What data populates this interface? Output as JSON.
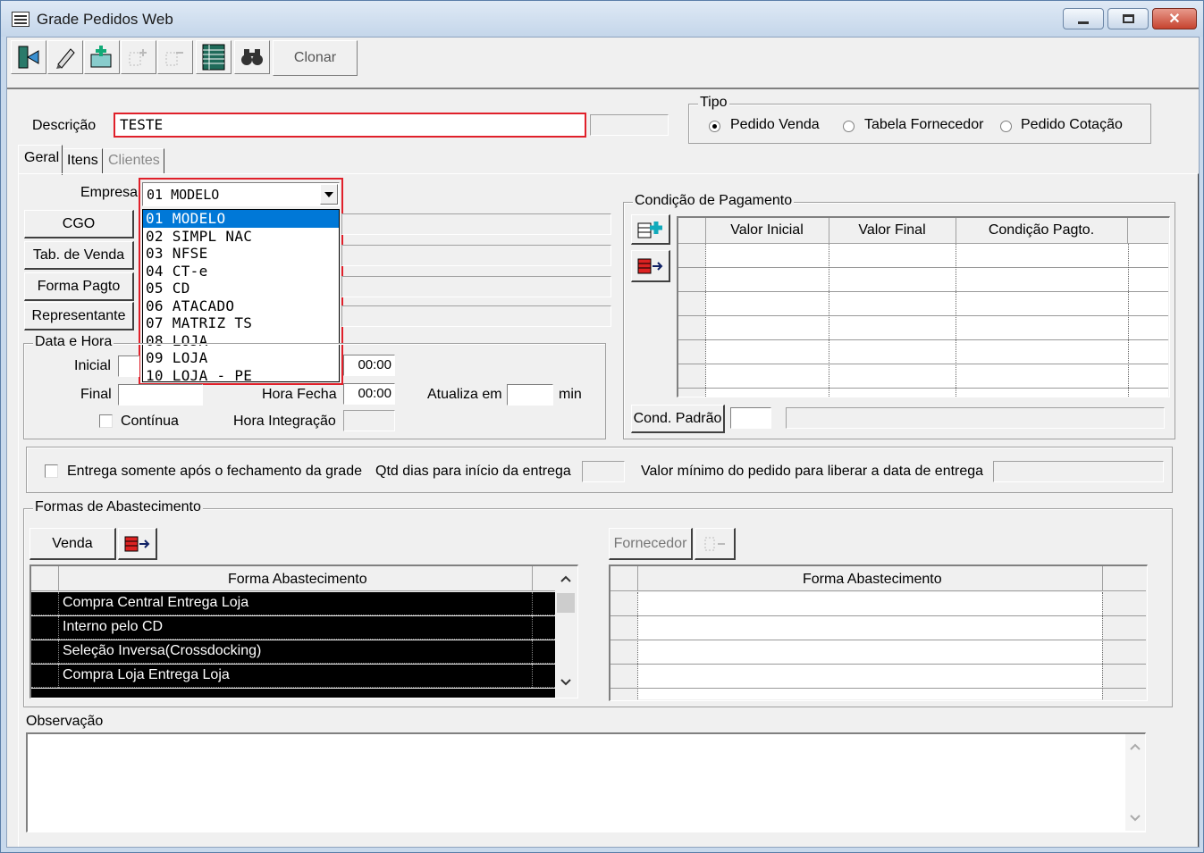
{
  "window": {
    "title": "Grade Pedidos Web"
  },
  "toolbar": {
    "clone_label": "Clonar"
  },
  "descricao": {
    "label": "Descrição",
    "value": "TESTE"
  },
  "tipo": {
    "title": "Tipo",
    "options": [
      "Pedido Venda",
      "Tabela Fornecedor",
      "Pedido Cotação"
    ],
    "selected": "Pedido Venda"
  },
  "tabs": [
    "Geral",
    "Itens",
    "Clientes"
  ],
  "empresa": {
    "label": "Empresa",
    "value": "01 MODELO",
    "options": [
      "01 MODELO",
      "02 SIMPL NAC",
      "03 NFSE",
      "04 CT-e",
      "05 CD",
      "06 ATACADO",
      "07 MATRIZ TS",
      "08 LOJA",
      "09 LOJA",
      "10 LOJA - PE"
    ]
  },
  "left_buttons": {
    "cgo": "CGO",
    "tab_venda": "Tab. de Venda",
    "forma_pagto": "Forma Pagto",
    "representante": "Representante"
  },
  "data_hora": {
    "title": "Data e Hora",
    "inicial": "Inicial",
    "final": "Final",
    "hora_fecha": "Hora Fecha",
    "hora_abre_value": "00:00",
    "hora_fecha_value": "00:00",
    "atualiza_em": "Atualiza em",
    "min": "min",
    "continua": "Contínua",
    "hora_integracao": "Hora Integração"
  },
  "condicao": {
    "title": "Condição de Pagamento",
    "columns": [
      "Valor Inicial",
      "Valor Final",
      "Condição Pagto."
    ],
    "cond_padrao": "Cond. Padrão"
  },
  "entrega": {
    "checkbox_label": "Entrega somente após o fechamento da grade",
    "qtd_dias": "Qtd dias para início da entrega",
    "valor_minimo": "Valor mínimo do pedido para liberar a data de entrega"
  },
  "abastecimento": {
    "title": "Formas de Abastecimento",
    "venda_btn": "Venda",
    "fornecedor_btn": "Fornecedor",
    "column": "Forma Abastecimento",
    "rows": [
      "Compra Central Entrega Loja",
      "Interno pelo CD",
      "Seleção Inversa(Crossdocking)",
      "Compra Loja Entrega Loja"
    ]
  },
  "observacao": {
    "label": "Observação"
  },
  "colors": {
    "highlight_border": "#e0202a",
    "selection": "#0078d7",
    "title_bg": "#c8d9ec"
  }
}
